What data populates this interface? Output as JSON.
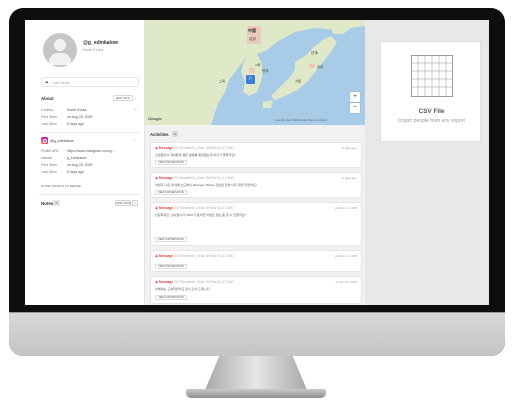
{
  "profile": {
    "name": "@g_edinkalow",
    "location": "South Korea"
  },
  "tags": {
    "placeholder": "Add labels"
  },
  "about": {
    "title": "About",
    "edit_label": "EDIT INFO",
    "rows": [
      {
        "key": "Country",
        "value": "South Korea"
      },
      {
        "key": "First Seen",
        "value": "on Aug 28, 2025"
      },
      {
        "key": "Last Seen",
        "value": "5 days ago"
      }
    ]
  },
  "instagram": {
    "name": "@g_edinkalow",
    "rows": [
      {
        "key": "Profile URL",
        "value": "https://www.instagram.com/g..."
      },
      {
        "key": "Handle",
        "value": "g_edinkalow"
      },
      {
        "key": "First Seen",
        "value": "on Aug 28, 2025"
      },
      {
        "key": "Last Seen",
        "value": "5 days ago"
      }
    ]
  },
  "find_link": "FIND PEOPLE TO MERGE",
  "notes": {
    "title": "Notes",
    "count": "0",
    "add_label": "ADD NOTE"
  },
  "map": {
    "google": "Google",
    "attribution": "Keys  Map data ©2025 Google  Map Terms  Report",
    "zoom_in": "+",
    "zoom_out": "−",
    "labels": [
      "中国",
      "北京",
      "한국",
      "日本",
      "서울",
      "東京",
      "上海",
      "大阪"
    ]
  },
  "activities": {
    "title": "Activities",
    "count": "6",
    "view_label": "VIEW CONVERSATION",
    "items": [
      {
        "title": "Message",
        "sub": "SG Showtime_Chat, SHOW Ep.1 CHAT",
        "date": "5 days ago",
        "body": "오랫동안의 계획끝에 결혼 날짜를 확정했는데 어디가 좋을까요?"
      },
      {
        "title": "Message",
        "sub": "SG Showtime_Chat, SHOW Ep.1 CHAT",
        "date": "5 days ago",
        "body": "이번주 나온 새 에피소드에서 Stranger Things 관련된 장면 너무 재미 있었어요!"
      },
      {
        "title": "Message",
        "sub": "SG Showtime_Chat, SHOW Ep.1 CHAT",
        "date": "on Dec 14, 2025",
        "body": "안녕하세요. 감사합니다 SWV가 참석한 이벤트 정보 좀 알 수 있을까요?"
      },
      {
        "title": "Message",
        "sub": "SG Showtime_Chat, SHOW Ep.1 CHAT",
        "date": "on Dec 14, 2025",
        "body": ""
      },
      {
        "title": "Message",
        "sub": "SG Showtime_Chat, SHOW Ep.1 CHAT",
        "date": "on Oct 22, 2025",
        "body": "새해에는 고생하셨어요 감사 인사 드립니다"
      }
    ]
  },
  "csv": {
    "title": "CSV File",
    "subtitle": "Import people from any export"
  },
  "colors": {
    "accent": "#e0413a",
    "instagram": "#d6249f",
    "map_water": "#a8cbe8",
    "map_land": "#dfe9c8"
  }
}
